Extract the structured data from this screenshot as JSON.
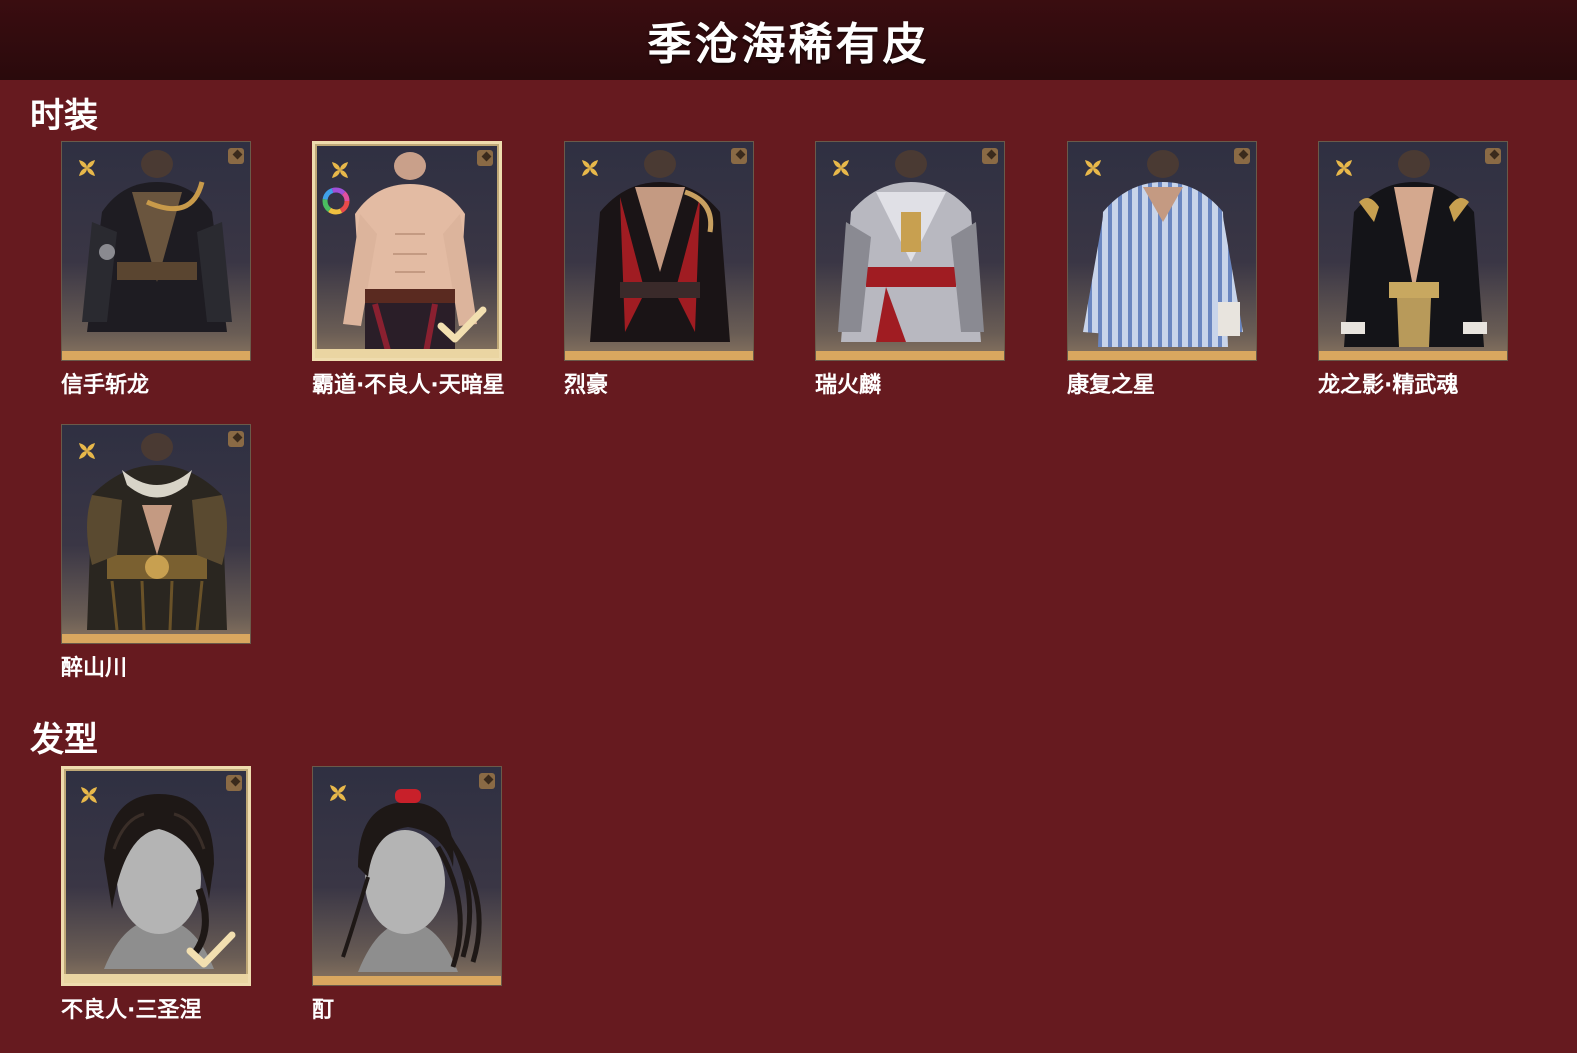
{
  "header": {
    "title": "季沧海稀有皮"
  },
  "sections": {
    "outfits": {
      "title": "时装",
      "items": [
        {
          "label": "信手斩龙"
        },
        {
          "label": "霸道·不良人·天暗星"
        },
        {
          "label": "烈豪"
        },
        {
          "label": "瑞火麟"
        },
        {
          "label": "康复之星"
        },
        {
          "label": "龙之影·精武魂"
        },
        {
          "label": "醉山川"
        }
      ]
    },
    "hairstyles": {
      "title": "发型",
      "items": [
        {
          "label": "不良人·三圣涅"
        },
        {
          "label": "酊"
        }
      ]
    }
  },
  "colors": {
    "background": "#661a1f",
    "header": "#2a0a0c",
    "rarity_bar": "#d9a75f",
    "selected_border": "#efdcae"
  }
}
